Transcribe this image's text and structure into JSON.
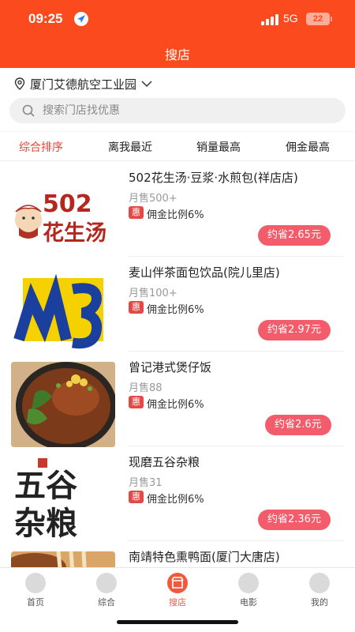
{
  "status_bar": {
    "time": "09:25",
    "network": "5G",
    "battery": "22"
  },
  "header": {
    "title": "搜店"
  },
  "location": {
    "text": "厦门艾德航空工业园"
  },
  "search": {
    "placeholder": "搜索门店找优惠"
  },
  "sort_tabs": [
    {
      "label": "综合排序",
      "active": true
    },
    {
      "label": "离我最近",
      "active": false
    },
    {
      "label": "销量最高",
      "active": false
    },
    {
      "label": "佣金最高",
      "active": false
    }
  ],
  "stores": [
    {
      "name": "502花生汤·豆浆·水煎包(祥店店)",
      "sales": "月售500+",
      "badge": "惠",
      "commission": "佣金比例6%",
      "save": "约省2.65元",
      "logo_text": "502花生汤"
    },
    {
      "name": "麦山伴茶面包饮品(院儿里店)",
      "sales": "月售100+",
      "badge": "惠",
      "commission": "佣金比例6%",
      "save": "约省2.97元",
      "logo_text": "M3"
    },
    {
      "name": "曾记港式煲仔饭",
      "sales": "月售88",
      "badge": "惠",
      "commission": "佣金比例6%",
      "save": "约省2.6元"
    },
    {
      "name": "现磨五谷杂粮",
      "sales": "月售31",
      "badge": "惠",
      "commission": "佣金比例6%",
      "save": "约省2.36元",
      "logo_text": "五谷杂粮"
    },
    {
      "name": "南靖特色熏鸭面(厦门大唐店)",
      "sales": "",
      "badge": "",
      "commission": "",
      "save": ""
    }
  ],
  "tabbar": [
    {
      "label": "首页",
      "icon": "home-icon",
      "active": false
    },
    {
      "label": "综合",
      "icon": "grid-icon",
      "active": false
    },
    {
      "label": "搜店",
      "icon": "store-icon",
      "active": true
    },
    {
      "label": "电影",
      "icon": "film-icon",
      "active": false
    },
    {
      "label": "我的",
      "icon": "user-icon",
      "active": false
    }
  ],
  "colors": {
    "brand": "#fb4a1e",
    "accent_pink": "#f35c6a",
    "active_tab": "#e8443b"
  }
}
